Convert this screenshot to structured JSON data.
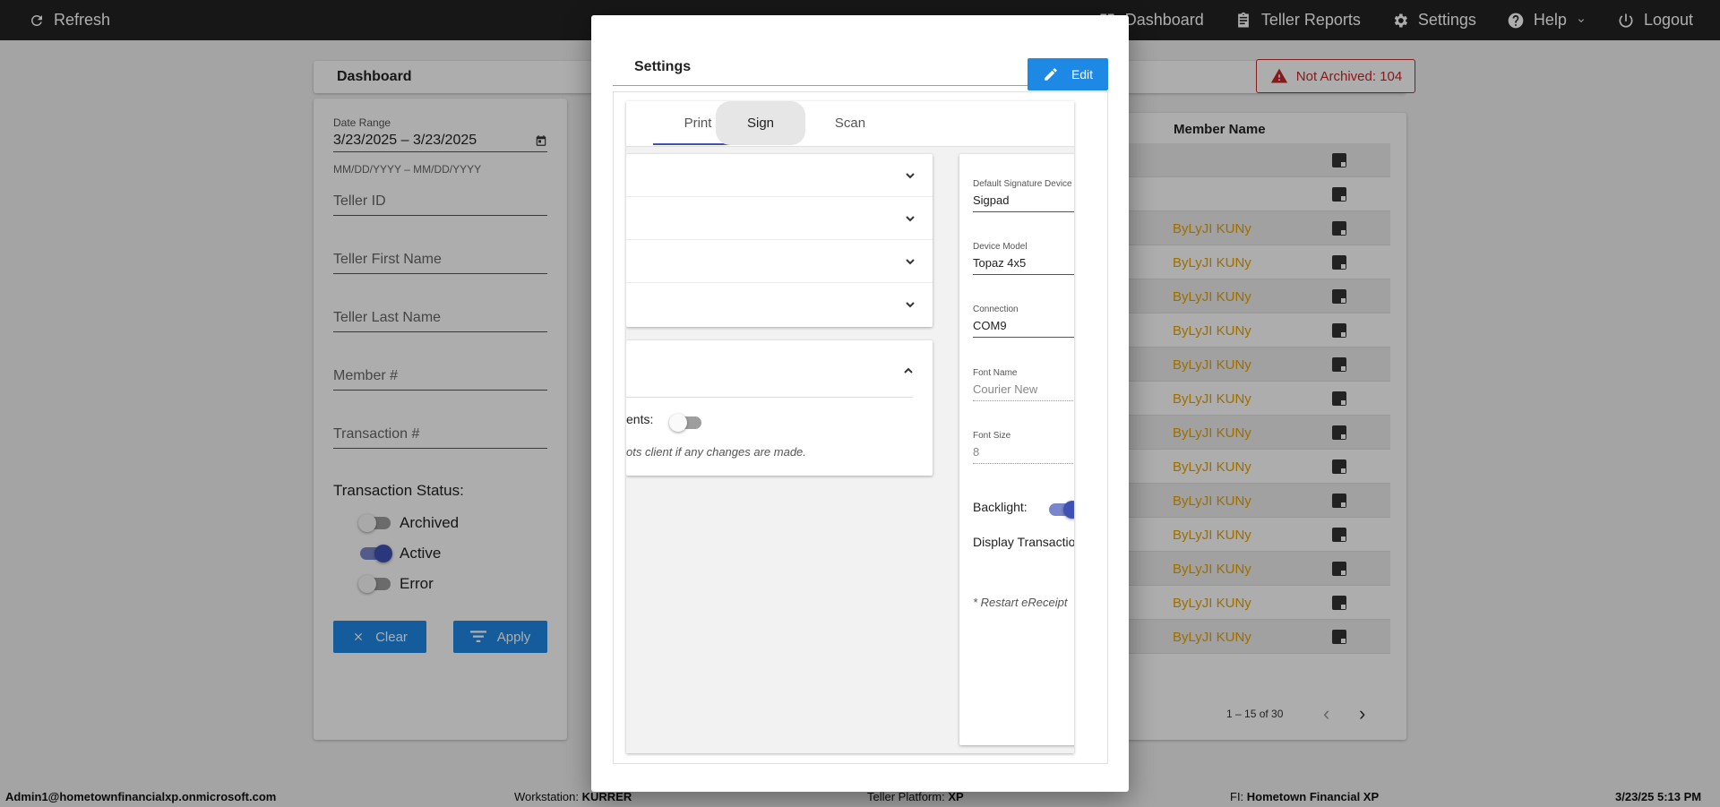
{
  "topbar": {
    "refresh_label": "Refresh",
    "nav": [
      {
        "label": "Dashboard",
        "icon": "dashboard-icon"
      },
      {
        "label": "Teller Reports",
        "icon": "clipboard-icon"
      },
      {
        "label": "Settings",
        "icon": "gear-icon"
      },
      {
        "label": "Help",
        "icon": "help-icon"
      },
      {
        "label": "Logout",
        "icon": "power-icon"
      }
    ]
  },
  "dashboard": {
    "title": "Dashboard",
    "not_archived_label": "Not Archived: 104"
  },
  "filters": {
    "date_range_label": "Date Range",
    "date_range_value": "3/23/2025 – 3/23/2025",
    "date_range_hint": "MM/DD/YYYY – MM/DD/YYYY",
    "teller_id": "Teller ID",
    "teller_first_name": "Teller First Name",
    "teller_last_name": "Teller Last Name",
    "member_number": "Member #",
    "transaction_number": "Transaction #",
    "status_title": "Transaction Status:",
    "statuses": [
      {
        "label": "Archived",
        "on": false
      },
      {
        "label": "Active",
        "on": true
      },
      {
        "label": "Error",
        "on": false
      }
    ],
    "clear_label": "Clear",
    "apply_label": "Apply"
  },
  "table": {
    "column_member_name": "Member Name",
    "rows": [
      "",
      "",
      "ByLyJI KUNy",
      "ByLyJI KUNy",
      "ByLyJI KUNy",
      "ByLyJI KUNy",
      "ByLyJI KUNy",
      "ByLyJI KUNy",
      "ByLyJI KUNy",
      "ByLyJI KUNy",
      "ByLyJI KUNy",
      "ByLyJI KUNy",
      "ByLyJI KUNy",
      "ByLyJI KUNy",
      "ByLyJI KUNy"
    ],
    "pager_text": "1 – 15 of 30"
  },
  "modal": {
    "title": "Settings",
    "edit_label": "Edit",
    "tabs": [
      "Print",
      "Sign",
      "Scan"
    ],
    "left_partial_label": "ents:",
    "left_partial_note": "ots client if any changes are made.",
    "sign": {
      "default_device_label": "Default Signature Device",
      "default_device_value": "Sigpad",
      "device_model_label": "Device Model",
      "device_model_value": "Topaz 4x5",
      "connection_label": "Connection",
      "connection_value": "COM9",
      "font_name_label": "Font Name",
      "font_name_value": "Courier New",
      "font_size_label": "Font Size",
      "font_size_value": "8",
      "backlight_label": "Backlight:",
      "display_transaction_label": "Display Transactio",
      "restart_note": "* Restart eReceipt"
    }
  },
  "statusbar": {
    "user": "Admin1@hometownfinancialxp.onmicrosoft.com",
    "workstation_label": "Workstation:",
    "workstation_value": "KURRER",
    "platform_label": "Teller Platform:",
    "platform_value": "XP",
    "fi_label": "FI:",
    "fi_value": "Hometown Financial XP",
    "datetime": "3/23/25 5:13 PM"
  }
}
